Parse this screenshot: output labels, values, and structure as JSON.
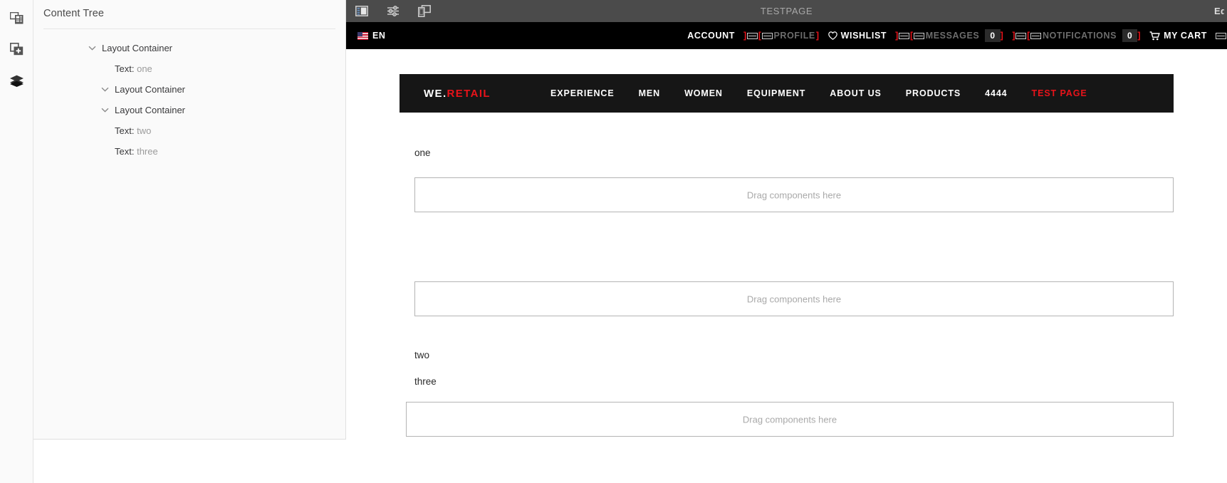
{
  "rail": {
    "items": [
      {
        "name": "assets-icon",
        "title": "Assets"
      },
      {
        "name": "components-icon",
        "title": "Components"
      },
      {
        "name": "layers-icon",
        "title": "Content Tree"
      }
    ]
  },
  "panel": {
    "title": "Content Tree",
    "tree": [
      {
        "label": "Layout Container",
        "value": "",
        "level": 1,
        "twisty": "chevron-down-icon"
      },
      {
        "label": "Text:",
        "value": "one",
        "level": 2,
        "twisty": ""
      },
      {
        "label": "Layout Container",
        "value": "",
        "level": 2,
        "twisty": "chevron-down-icon"
      },
      {
        "label": "Layout Container",
        "value": "",
        "level": 2,
        "twisty": "chevron-down-icon"
      },
      {
        "label": "Text:",
        "value": "two",
        "level": 3,
        "twisty": ""
      },
      {
        "label": "Text:",
        "value": "three",
        "level": 3,
        "twisty": ""
      }
    ]
  },
  "toolbar": {
    "page_title": "TESTPAGE",
    "edit_label": "Edit",
    "buttons": [
      {
        "name": "toggle-side-panel-icon",
        "title": "Toggle Side Panel"
      },
      {
        "name": "page-properties-icon",
        "title": "Page Information"
      },
      {
        "name": "emulator-device-icon",
        "title": "Layer / Emulator"
      }
    ]
  },
  "site": {
    "utility": {
      "language": "EN",
      "language_flag": "us-flag-icon",
      "items": [
        {
          "type": "text",
          "label": "ACCOUNT",
          "icon": "",
          "badge": ""
        },
        {
          "type": "broken",
          "label": "PROFILE",
          "icon": "broken-image-icon",
          "badge": ""
        },
        {
          "type": "text",
          "label": "WISHLIST",
          "icon": "heart-icon",
          "badge": ""
        },
        {
          "type": "broken",
          "label": "MESSAGES",
          "icon": "broken-image-icon",
          "badge": "0"
        },
        {
          "type": "broken",
          "label": "NOTIFICATIONS",
          "icon": "broken-image-icon",
          "badge": "0"
        },
        {
          "type": "text",
          "label": "MY CART",
          "icon": "cart-icon",
          "badge": ""
        }
      ]
    },
    "brand": {
      "part1": "WE.",
      "part2": "RETAIL"
    },
    "nav": [
      {
        "label": "EXPERIENCE",
        "active": false
      },
      {
        "label": "MEN",
        "active": false
      },
      {
        "label": "WOMEN",
        "active": false
      },
      {
        "label": "EQUIPMENT",
        "active": false
      },
      {
        "label": "ABOUT US",
        "active": false
      },
      {
        "label": "PRODUCTS",
        "active": false
      },
      {
        "label": "4444",
        "active": false
      },
      {
        "label": "TEST PAGE",
        "active": true
      }
    ],
    "content": {
      "text_one": "one",
      "text_two": "two",
      "text_three": "three",
      "dropzone_hint": "Drag components here"
    }
  },
  "colors": {
    "brand_red": "#e8131a",
    "toolbar_bg": "#4b4b4b",
    "nav_bg": "#161616",
    "panel_bg": "#fafafa"
  }
}
